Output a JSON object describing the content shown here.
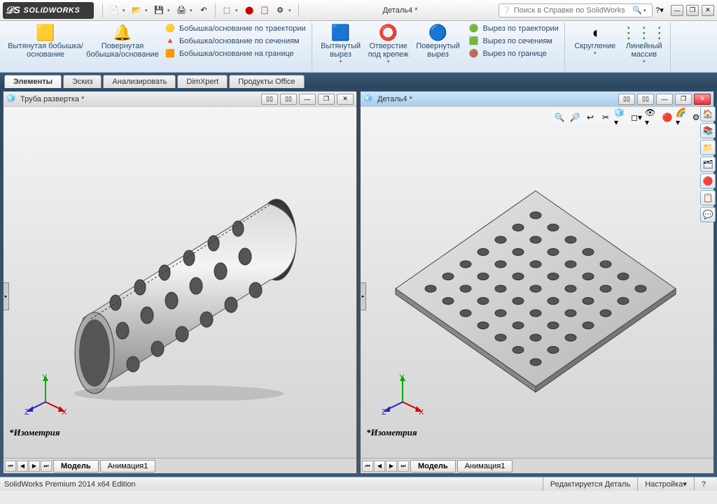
{
  "title": "Деталь4 *",
  "search_placeholder": "Поиск в Справке по SolidWorks",
  "logo_text": "SOLIDWORKS",
  "ribbon": {
    "extruded_boss": "Вытянутая бобышка/основание",
    "revolved_boss": "Повернутая бобышка/основание",
    "swept_boss": "Бобышка/основание по траектории",
    "lofted_boss": "Бобышка/основание по сечениям",
    "boundary_boss": "Бобышка/основание на границе",
    "extruded_cut": "Вытянутый вырез",
    "hole_wizard": "Отверстие под крепеж",
    "revolved_cut": "Повернутый вырез",
    "swept_cut": "Вырез по траектории",
    "lofted_cut": "Вырез по сечениям",
    "boundary_cut": "Вырез по границе",
    "fillet": "Скругление",
    "linear_pattern": "Линейный массив"
  },
  "tabs": {
    "features": "Элементы",
    "sketch": "Эскиз",
    "evaluate": "Анализировать",
    "dimxpert": "DimXpert",
    "office": "Продукты Office"
  },
  "docs": {
    "left": {
      "title": "Труба развертка *",
      "view": "*Изометрия",
      "tab_model": "Модель",
      "tab_anim": "Анимация1"
    },
    "right": {
      "title": "Деталь4 *",
      "view": "*Изометрия",
      "tab_model": "Модель",
      "tab_anim": "Анимация1"
    }
  },
  "status": {
    "edition": "SolidWorks Premium 2014 x64 Edition",
    "editing": "Редактируется Деталь",
    "custom": "Настройка"
  }
}
